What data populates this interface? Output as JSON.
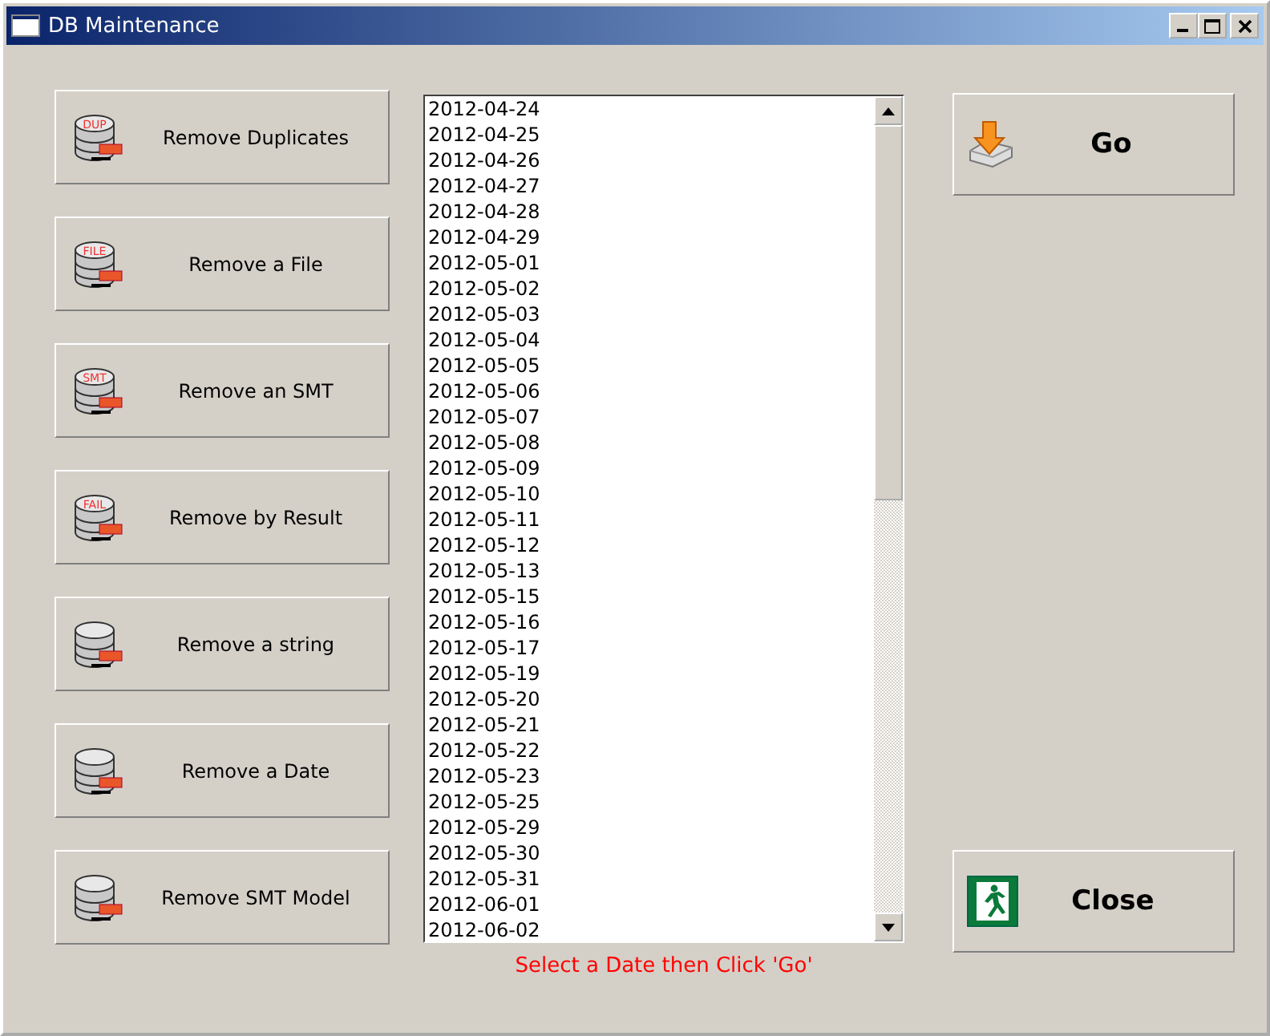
{
  "window": {
    "title": "DB Maintenance"
  },
  "actions": [
    {
      "label": "Remove Duplicates",
      "badge": "DUP"
    },
    {
      "label": "Remove a File",
      "badge": "FILE"
    },
    {
      "label": "Remove an SMT",
      "badge": "SMT"
    },
    {
      "label": "Remove by Result",
      "badge": "FAIL"
    },
    {
      "label": "Remove a string"
    },
    {
      "label": "Remove a Date"
    },
    {
      "label": "Remove SMT Model"
    }
  ],
  "dates": [
    "2012-04-24",
    "2012-04-25",
    "2012-04-26",
    "2012-04-27",
    "2012-04-28",
    "2012-04-29",
    "2012-05-01",
    "2012-05-02",
    "2012-05-03",
    "2012-05-04",
    "2012-05-05",
    "2012-05-06",
    "2012-05-07",
    "2012-05-08",
    "2012-05-09",
    "2012-05-10",
    "2012-05-11",
    "2012-05-12",
    "2012-05-13",
    "2012-05-15",
    "2012-05-16",
    "2012-05-17",
    "2012-05-19",
    "2012-05-20",
    "2012-05-21",
    "2012-05-22",
    "2012-05-23",
    "2012-05-25",
    "2012-05-29",
    "2012-05-30",
    "2012-05-31",
    "2012-06-01",
    "2012-06-02"
  ],
  "hint": "Select a Date then Click 'Go'",
  "buttons": [
    {
      "kind": "go",
      "label": "Go"
    },
    {
      "kind": "close",
      "label": "Close"
    }
  ]
}
